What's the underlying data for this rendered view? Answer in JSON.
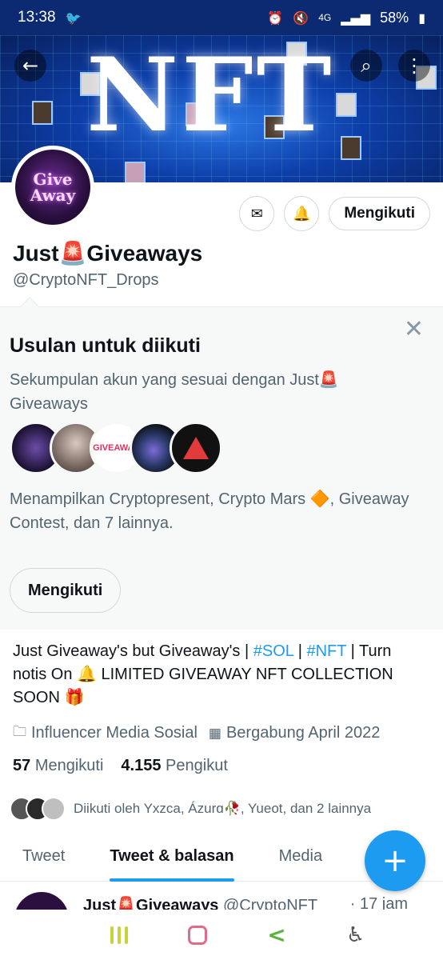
{
  "status_bar": {
    "time": "13:38",
    "battery": "58%",
    "network": "4G"
  },
  "banner": {
    "text": "NFT",
    "back_icon": "arrow-left-icon",
    "search_icon": "search-icon",
    "more_icon": "more-vertical-icon"
  },
  "profile": {
    "avatar_text_1": "Give",
    "avatar_text_2": "Away",
    "name": "Just🚨Giveaways",
    "handle": "@CryptoNFT_Drops",
    "follow_state_label": "Mengikuti"
  },
  "suggestions": {
    "title": "Usulan untuk diikuti",
    "description": "Sekumpulan akun yang sesuai dengan Just🚨 Giveaways",
    "featured": "Menampilkan Cryptopresent, Crypto Mars 🔶, Giveaway Contest, dan 7 lainnya.",
    "button_label": "Mengikuti",
    "avatar_3_text": "GIVEAWAY"
  },
  "bio": {
    "part1": "Just Giveaway's but Giveaway's | ",
    "tag1": "#SOL",
    "sep": " | ",
    "tag2": "#NFT",
    "part2": " | Turn notis On 🔔 LIMITED GIVEAWAY NFT COLLECTION SOON 🎁"
  },
  "meta": {
    "category": "Influencer Media Sosial",
    "joined": "Bergabung April 2022"
  },
  "counts": {
    "following_num": "57",
    "following_label": "Mengikuti",
    "followers_num": "4.155",
    "followers_label": "Pengikut"
  },
  "followed_by": "Diikuti oleh Yxzca, Ázurɑ🥀, Yueot, dan 2 lainnya",
  "tabs": [
    {
      "label": "Tweet"
    },
    {
      "label": "Tweet & balasan"
    },
    {
      "label": "Media"
    }
  ],
  "tweet_peek": {
    "name": "Just🚨Giveaways",
    "handle": "@CryptoNFT",
    "time": "· 17 jam"
  },
  "colors": {
    "accent": "#1d9bf0",
    "secondary_text": "#536471"
  }
}
